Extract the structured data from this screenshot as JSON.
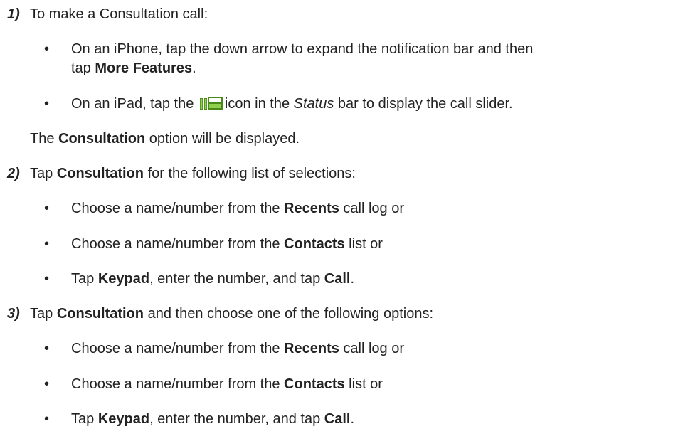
{
  "steps": [
    {
      "number": "1)",
      "text": "To make a Consultation call:",
      "bullets": [
        {
          "line1": {
            "pre": "On an iPhone, tap the down arrow to expand the notification bar and then"
          },
          "line2": {
            "pre": "tap ",
            "bold": "More Features",
            "post": "."
          }
        },
        {
          "pre": "On an iPad, tap the ",
          "icon": "call-slider-icon",
          "mid": "icon in the ",
          "italic": "Status",
          "post": " bar to display the call slider."
        }
      ],
      "note": {
        "pre": "The ",
        "bold": "Consultation",
        "post": " option will be displayed."
      }
    },
    {
      "number": "2)",
      "text": {
        "pre": "Tap ",
        "bold": "Consultation",
        "post": " for the following list of selections:"
      },
      "bullets": [
        {
          "pre": "Choose a name/number from the ",
          "bold": "Recents",
          "post": " call log or"
        },
        {
          "pre": "Choose a name/number from the ",
          "bold": "Contacts",
          "post": " list or"
        },
        {
          "pre": "Tap ",
          "bold": "Keypad",
          "mid": ", enter the number, and tap ",
          "bold2": "Call",
          "post": "."
        }
      ]
    },
    {
      "number": "3)",
      "text": {
        "pre": "Tap ",
        "bold": "Consultation",
        "post": " and then choose one of the following options:"
      },
      "bullets": [
        {
          "pre": "Choose a name/number from the ",
          "bold": "Recents",
          "post": " call log or"
        },
        {
          "pre": "Choose a name/number from the ",
          "bold": "Contacts",
          "post": " list or"
        },
        {
          "pre": "Tap ",
          "bold": "Keypad",
          "mid": ", enter the number, and tap ",
          "bold2": "Call",
          "post": "."
        }
      ]
    }
  ],
  "bullet_char": "•",
  "colors": {
    "text": "#222222",
    "icon_green": "#4a8a1a",
    "icon_light": "#8fd14f"
  }
}
